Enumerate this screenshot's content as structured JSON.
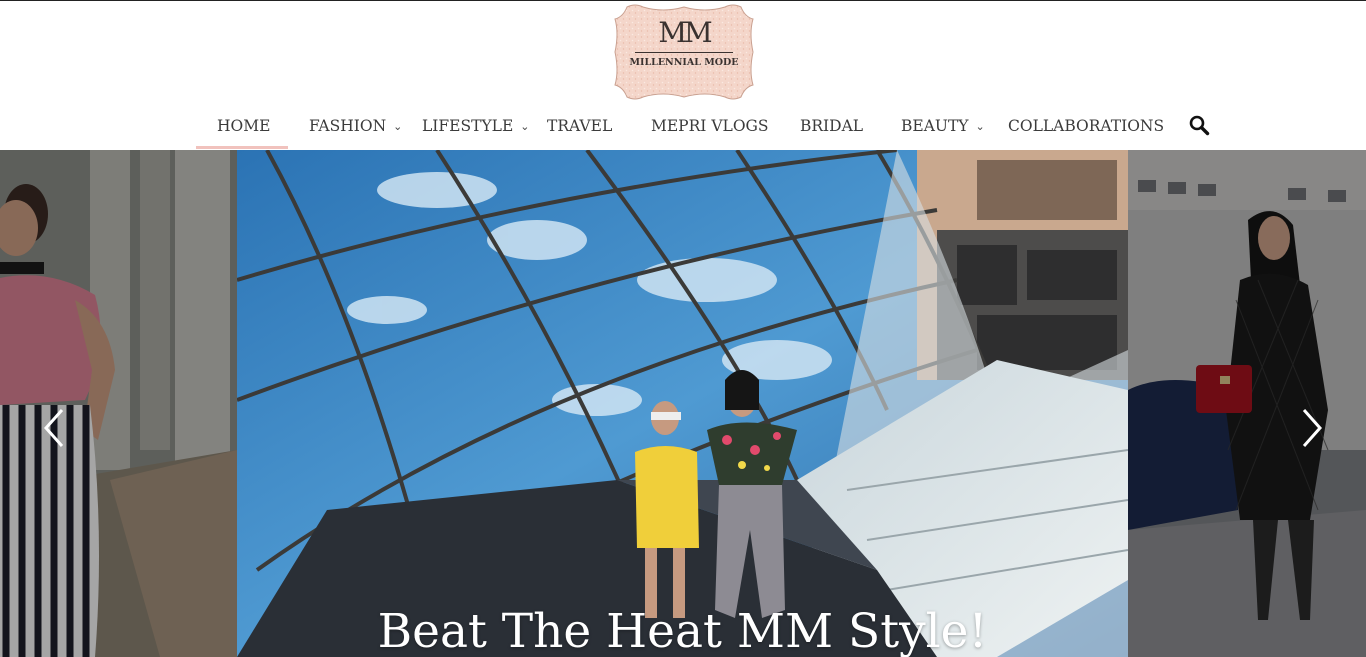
{
  "site": {
    "logo_mark": "MM",
    "logo_text": "MILLENNIAL MODE"
  },
  "nav": {
    "items": [
      {
        "label": "HOME",
        "has_dropdown": false,
        "active": true
      },
      {
        "label": "FASHION",
        "has_dropdown": true
      },
      {
        "label": "LIFESTYLE",
        "has_dropdown": true
      },
      {
        "label": "TRAVEL",
        "has_dropdown": false
      },
      {
        "label": "MEPRI VLOGS",
        "has_dropdown": false
      },
      {
        "label": "BRIDAL",
        "has_dropdown": false
      },
      {
        "label": "BEAUTY",
        "has_dropdown": true
      },
      {
        "label": "COLLABORATIONS",
        "has_dropdown": false
      }
    ],
    "chevron_glyph": "⌄",
    "search_icon": "search-icon"
  },
  "slider": {
    "caption": "Beat The Heat MM Style!",
    "prev_icon": "chevron-left-icon",
    "next_icon": "chevron-right-icon"
  },
  "colors": {
    "nav_text": "#3b3b3b",
    "active_underline": "#f1c2bd",
    "logo_badge": "#f3d1c6"
  }
}
